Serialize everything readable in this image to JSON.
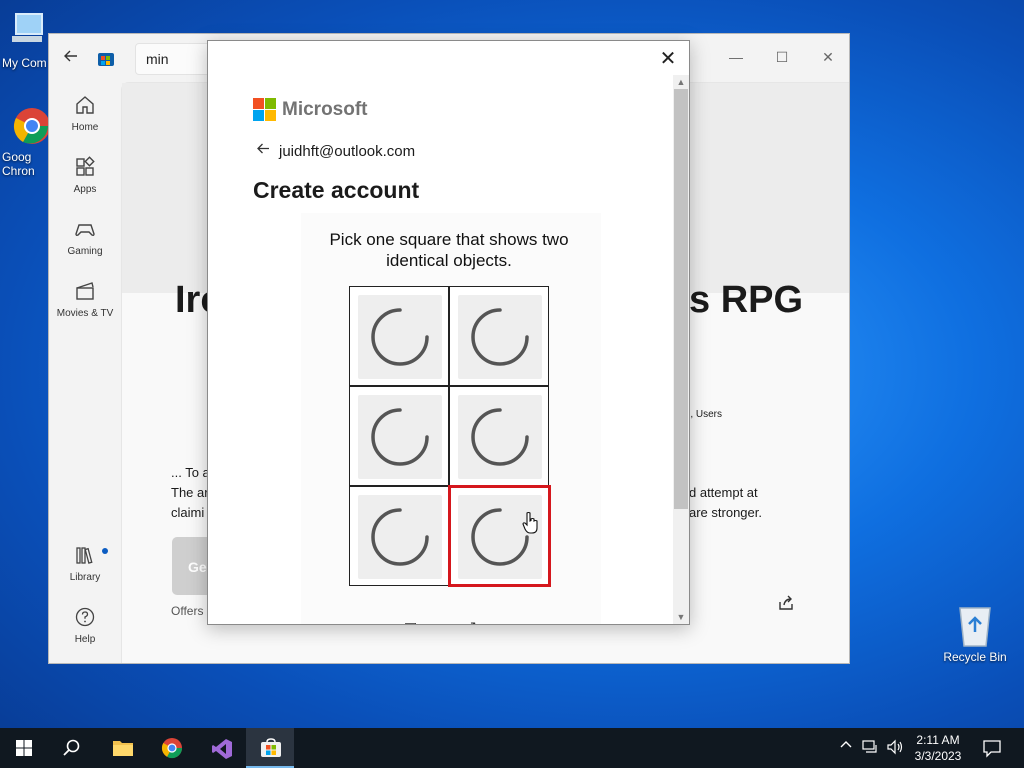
{
  "desktop": {
    "icons": [
      {
        "label": "My Com"
      },
      {
        "label": "Goog Chron"
      }
    ],
    "recycle_bin": "Recycle Bin"
  },
  "store": {
    "search_value": "min",
    "nav": [
      {
        "label": "Home",
        "icon": "home-icon"
      },
      {
        "label": "Apps",
        "icon": "apps-icon"
      },
      {
        "label": "Gaming",
        "icon": "gaming-icon"
      },
      {
        "label": "Movies & TV",
        "icon": "movies-icon"
      },
      {
        "label": "Library",
        "icon": "library-icon"
      },
      {
        "label": "Help",
        "icon": "help-icon"
      }
    ],
    "title_left": "Iro",
    "title_right": "s RPG",
    "meta_right": "), Users",
    "desc_line1_left": "... To a",
    "desc_line2_left": "The ar",
    "desc_line3_left": "claimi",
    "desc_line2_right": "d attempt at",
    "desc_line3_right": "are stronger.",
    "get_button": "Ge",
    "offers": "Offers i"
  },
  "dialog": {
    "close_label": "✕",
    "brand": "Microsoft",
    "email": "juidhft@outlook.com",
    "heading": "Create account",
    "prompt": "Pick one square that shows two identical objects.",
    "tiles": 6,
    "selected_tile_index": 5
  },
  "taskbar": {
    "clock_time": "2:11 AM",
    "clock_date": "3/3/2023"
  },
  "colors": {
    "selection_red": "#d5171d",
    "ms_red": "#f25022",
    "ms_green": "#7fba00",
    "ms_blue": "#00a4ef",
    "ms_yellow": "#ffb900"
  }
}
